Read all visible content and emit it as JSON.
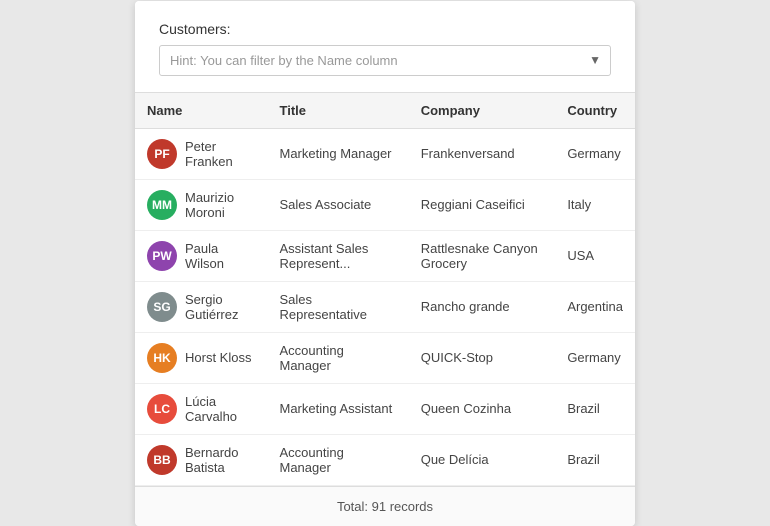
{
  "filter": {
    "label": "Customers:",
    "placeholder": "Hint: You can filter by the Name column"
  },
  "table": {
    "columns": [
      "Name",
      "Title",
      "Company",
      "Country"
    ],
    "rows": [
      {
        "name": "Peter Franken",
        "title": "Marketing Manager",
        "company": "Frankenversand",
        "country": "Germany",
        "initials": "PF",
        "avatarClass": "avatar-1"
      },
      {
        "name": "Maurizio Moroni",
        "title": "Sales Associate",
        "company": "Reggiani Caseifici",
        "country": "Italy",
        "initials": "MM",
        "avatarClass": "avatar-2"
      },
      {
        "name": "Paula Wilson",
        "title": "Assistant Sales Represent...",
        "company": "Rattlesnake Canyon Grocery",
        "country": "USA",
        "initials": "PW",
        "avatarClass": "avatar-3"
      },
      {
        "name": "Sergio Gutiérrez",
        "title": "Sales Representative",
        "company": "Rancho grande",
        "country": "Argentina",
        "initials": "SG",
        "avatarClass": "avatar-4"
      },
      {
        "name": "Horst Kloss",
        "title": "Accounting Manager",
        "company": "QUICK-Stop",
        "country": "Germany",
        "initials": "HK",
        "avatarClass": "avatar-5"
      },
      {
        "name": "Lúcia Carvalho",
        "title": "Marketing Assistant",
        "company": "Queen Cozinha",
        "country": "Brazil",
        "initials": "LC",
        "avatarClass": "avatar-6"
      },
      {
        "name": "Bernardo Batista",
        "title": "Accounting Manager",
        "company": "Que Delícia",
        "country": "Brazil",
        "initials": "BB",
        "avatarClass": "avatar-7"
      }
    ]
  },
  "footer": {
    "total": "Total: 91 records"
  }
}
